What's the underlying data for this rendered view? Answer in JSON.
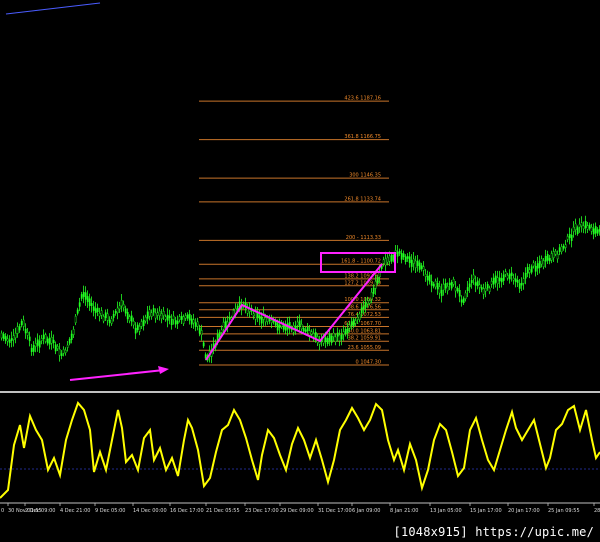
{
  "fib_levels": [
    {
      "label": "423.6  1187.16",
      "ratio": 423.6
    },
    {
      "label": "361.8  1166.75",
      "ratio": 361.8
    },
    {
      "label": "300  1146.35",
      "ratio": 300
    },
    {
      "label": "261.8  1133.74",
      "ratio": 261.8
    },
    {
      "label": "200 - 1113.33",
      "ratio": 200
    },
    {
      "label": "161.8 -   1100.72",
      "ratio": 161.8
    },
    {
      "label": "138.2  1092.93",
      "ratio": 138.2
    },
    {
      "label": "127.2  1089.30",
      "ratio": 127.2
    },
    {
      "label": "100.0  1080.32",
      "ratio": 100
    },
    {
      "label": "88.6  1076.56",
      "ratio": 88.6
    },
    {
      "label": "76.4  1072.53",
      "ratio": 76.4
    },
    {
      "label": "61.8 - 1067.70",
      "ratio": 61.8
    },
    {
      "label": "50.0  1063.81",
      "ratio": 50
    },
    {
      "label": "38.2  1059.91",
      "ratio": 38.2
    },
    {
      "label": "23.6  1055.09",
      "ratio": 23.6
    },
    {
      "label": "0  1047.30",
      "ratio": 0
    }
  ],
  "dates": [
    "30 Nov 01:55",
    "2 Dec 09:00",
    "4 Dec 21:00",
    "9 Dec 05:00",
    "14 Dec 00:00",
    "16 Dec 17:00",
    "21 Dec 05:55",
    "23 Dec 17:00",
    "29 Dec 09:00",
    "31 Dec 17:00",
    "6 Jan 09:00",
    "8 Jan 21:00",
    "13 Jan 05:00",
    "15 Jan 17:00",
    "20 Jan 17:00",
    "25 Jan 09:55",
    "28"
  ],
  "left_edge_tick": "0",
  "watermark": "[1048x915] https://upic.me/",
  "colors": {
    "background": "#000000",
    "bull_candles": "#22ff22",
    "fib_lines": "#c8742a",
    "fib_labels": "#f08a2a",
    "pattern_lines": "#ff22ff",
    "oscillator": "#ffff00",
    "separator": "#ffffff"
  }
}
